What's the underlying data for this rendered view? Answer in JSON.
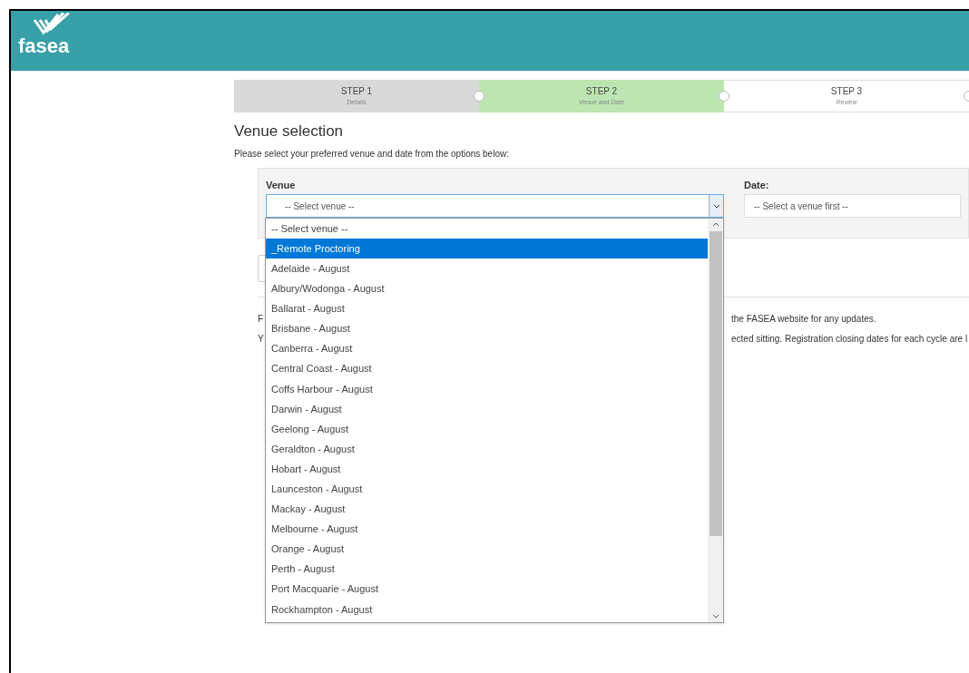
{
  "header": {
    "logo_text": "fasea"
  },
  "steps": [
    {
      "label": "STEP 1",
      "sublabel": "Details",
      "kind": "done"
    },
    {
      "label": "STEP 2",
      "sublabel": "Venue and Date",
      "kind": "current"
    },
    {
      "label": "STEP 3",
      "sublabel": "Review",
      "kind": "todo"
    }
  ],
  "heading": "Venue selection",
  "instruction": "Please select your preferred venue and date from the options below:",
  "venue": {
    "label": "Venue",
    "value": "-- Select venue --",
    "expanded": true
  },
  "date": {
    "label": "Date:",
    "value": "-- Select a venue first --"
  },
  "venue_options": [
    {
      "label": "-- Select venue --",
      "selected": false
    },
    {
      "label": "_Remote Proctoring",
      "selected": true
    },
    {
      "label": "Adelaide - August",
      "selected": false
    },
    {
      "label": "Albury/Wodonga - August",
      "selected": false
    },
    {
      "label": "Ballarat - August",
      "selected": false
    },
    {
      "label": "Brisbane - August",
      "selected": false
    },
    {
      "label": "Canberra - August",
      "selected": false
    },
    {
      "label": "Central Coast - August",
      "selected": false
    },
    {
      "label": "Coffs Harbour - August",
      "selected": false
    },
    {
      "label": "Darwin - August",
      "selected": false
    },
    {
      "label": "Geelong - August",
      "selected": false
    },
    {
      "label": "Geraldton - August",
      "selected": false
    },
    {
      "label": "Hobart - August",
      "selected": false
    },
    {
      "label": "Launceston - August",
      "selected": false
    },
    {
      "label": "Mackay - August",
      "selected": false
    },
    {
      "label": "Melbourne - August",
      "selected": false
    },
    {
      "label": "Orange - August",
      "selected": false
    },
    {
      "label": "Perth - August",
      "selected": false
    },
    {
      "label": "Port Macquarie - August",
      "selected": false
    },
    {
      "label": "Rockhampton - August",
      "selected": false
    }
  ],
  "notes": [
    {
      "left": "F",
      "right": "the FASEA website for any updates."
    },
    {
      "left": "Y",
      "right": "ected sitting. Registration closing dates for each cycle are l"
    }
  ]
}
